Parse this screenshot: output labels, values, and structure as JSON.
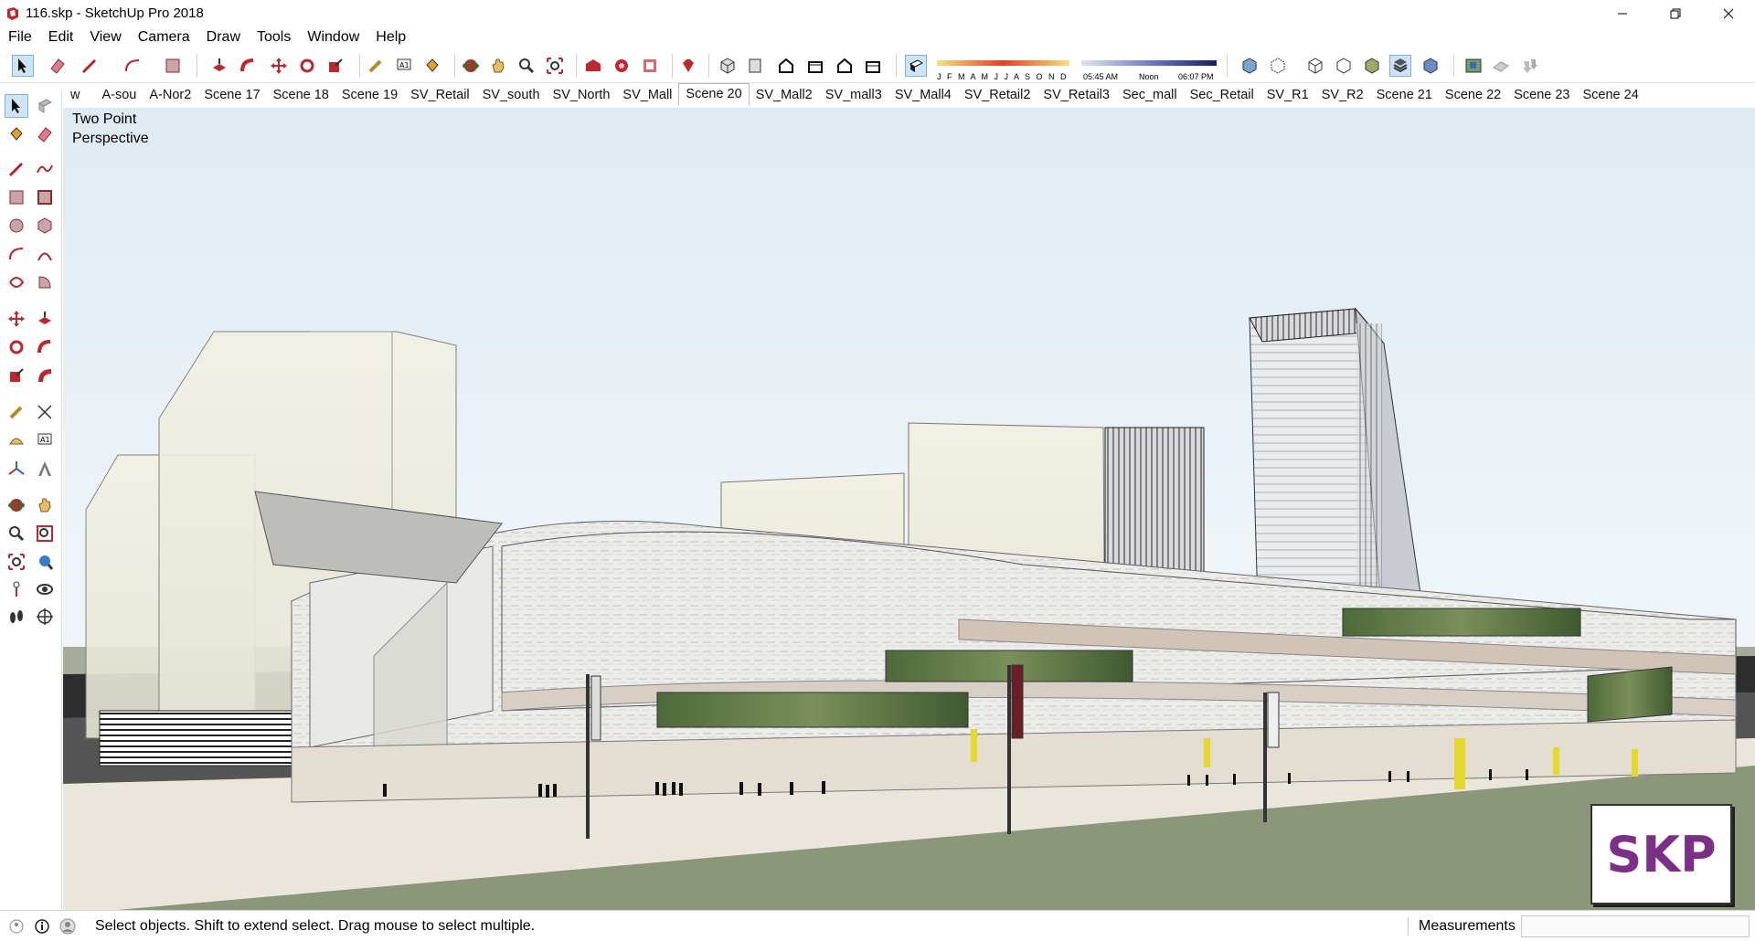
{
  "window": {
    "title": "116.skp - SketchUp Pro 2018",
    "accent": "#c0262d"
  },
  "menu": [
    "File",
    "Edit",
    "View",
    "Camera",
    "Draw",
    "Tools",
    "Window",
    "Help"
  ],
  "toolbar": {
    "buttons": [
      "select-icon",
      "eraser-icon",
      "pencil-icon",
      "arc-icon",
      "rectangle-icon",
      "push-pull-icon",
      "follow-me-icon",
      "move-icon",
      "rotate-icon",
      "scale-icon",
      "tape-measure-icon",
      "text-icon",
      "paint-bucket-icon",
      "orbit-icon",
      "pan-icon",
      "zoom-icon",
      "zoom-extents-icon",
      "warehouse-icon",
      "extension-warehouse-icon",
      "layout-icon",
      "ruby-icon",
      "iso-view-icon",
      "top-view-icon",
      "front-view-icon",
      "right-view-icon",
      "back-view-icon",
      "left-view-icon",
      "shadows-icon",
      "xray-icon",
      "wireframe-icon",
      "hidden-line-icon",
      "shaded-icon",
      "textured-icon",
      "monochrome-icon",
      "geolocation-icon",
      "sandbox-icon",
      "terrain-icon"
    ],
    "shadow_months": "J F M A M J J A S O N D",
    "shadow_times": {
      "start": "05:45 AM",
      "mid": "Noon",
      "end": "06:07 PM"
    }
  },
  "scenes": {
    "tabs": [
      "w",
      "A-sou",
      "A-Nor2",
      "Scene 17",
      "Scene 18",
      "Scene 19",
      "SV_Retail",
      "SV_south",
      "SV_North",
      "SV_Mall",
      "Scene 20",
      "SV_Mall2",
      "SV_mall3",
      "SV_Mall4",
      "SV_Retail2",
      "SV_Retail3",
      "Sec_mall",
      "Sec_Retail",
      "SV_R1",
      "SV_R2",
      "Scene 21",
      "Scene 22",
      "Scene 23",
      "Scene 24"
    ],
    "active": "Scene 20"
  },
  "palette": [
    "select-icon",
    "component-icon",
    "paint-bucket-icon",
    "eraser-icon",
    "line-icon",
    "freehand-icon",
    "rectangle-icon",
    "rotated-rectangle-icon",
    "circle-icon",
    "polygon-icon",
    "arc-icon",
    "two-point-arc-icon",
    "three-point-arc-icon",
    "pie-icon",
    "move-icon",
    "push-pull-icon",
    "rotate-icon",
    "follow-me-icon",
    "scale-icon",
    "offset-icon",
    "tape-measure-icon",
    "dimension-icon",
    "protractor-icon",
    "text-icon",
    "axes-icon",
    "3d-text-icon",
    "orbit-icon",
    "pan-icon",
    "zoom-icon",
    "zoom-window-icon",
    "zoom-extents-icon",
    "previous-view-icon",
    "position-camera-icon",
    "look-around-icon",
    "walk-icon",
    "section-plane-icon"
  ],
  "viewport": {
    "label_line1": "Two Point",
    "label_line2": "Perspective",
    "badge": "SKP"
  },
  "status": {
    "hint": "Select objects. Shift to extend select. Drag mouse to select multiple.",
    "measurements_label": "Measurements",
    "measurements_value": ""
  }
}
